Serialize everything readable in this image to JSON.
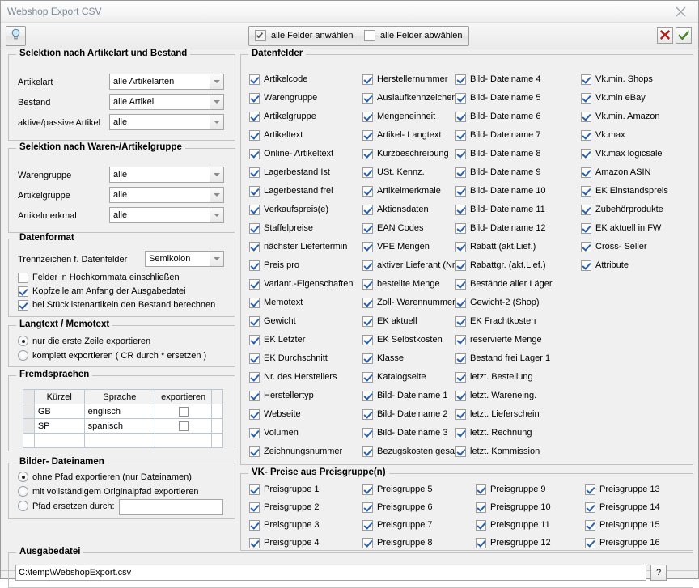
{
  "window": {
    "title": "Webshop Export CSV",
    "close_icon": "close-icon"
  },
  "toolbar": {
    "bulb_icon": "lightbulb-icon",
    "select_all_label": "alle Felder anwählen",
    "deselect_all_label": "alle Felder abwählen",
    "cancel_icon": "red-x-icon",
    "ok_icon": "green-check-icon"
  },
  "selection_article": {
    "title": "Selektion nach Artikelart und Bestand",
    "rows": [
      {
        "label": "Artikelart",
        "value": "alle Artikelarten"
      },
      {
        "label": "Bestand",
        "value": "alle Artikel"
      },
      {
        "label": "aktive/passive Artikel",
        "value": "alle"
      }
    ]
  },
  "selection_group": {
    "title": "Selektion nach Waren-/Artikelgruppe",
    "rows": [
      {
        "label": "Warengruppe",
        "value": "alle"
      },
      {
        "label": "Artikelgruppe",
        "value": "alle"
      },
      {
        "label": "Artikelmerkmal",
        "value": "alle"
      }
    ]
  },
  "datenformat": {
    "title": "Datenformat",
    "separator_label": "Trennzeichen f. Datenfelder",
    "separator_value": "Semikolon",
    "options": [
      {
        "label": "Felder in Hochkommata einschließen",
        "checked": false
      },
      {
        "label": "Kopfzeile am Anfang der Ausgabedatei",
        "checked": true
      },
      {
        "label": "bei Stücklistenartikeln den Bestand berechnen",
        "checked": true
      }
    ]
  },
  "langtext": {
    "title": "Langtext / Memotext",
    "options": [
      {
        "label": "nur die erste Zeile exportieren",
        "selected": true
      },
      {
        "label": "komplett exportieren ( CR durch * ersetzen )",
        "selected": false
      }
    ]
  },
  "fremdsprachen": {
    "title": "Fremdsprachen",
    "columns": [
      "Kürzel",
      "Sprache",
      "exportieren"
    ],
    "rows": [
      {
        "kuerzel": "GB",
        "sprache": "englisch",
        "exportieren": false
      },
      {
        "kuerzel": "SP",
        "sprache": "spanisch",
        "exportieren": false
      }
    ]
  },
  "bilder": {
    "title": "Bilder- Dateinamen",
    "options": [
      {
        "label": "ohne Pfad exportieren (nur Dateinamen)",
        "selected": true
      },
      {
        "label": "mit vollständigem Originalpfad exportieren",
        "selected": false
      },
      {
        "label": "Pfad ersetzen durch:",
        "selected": false
      }
    ],
    "replace_path_value": ""
  },
  "datenfelder": {
    "title": "Datenfelder",
    "columns": [
      {
        "items": [
          {
            "label": "Artikelcode",
            "checked": true
          },
          {
            "label": "Warengruppe",
            "checked": true
          },
          {
            "label": "Artikelgruppe",
            "checked": true
          },
          {
            "label": "Artikeltext",
            "checked": true
          },
          {
            "label": "Online- Artikeltext",
            "checked": true
          },
          {
            "label": "Lagerbestand Ist",
            "checked": true
          },
          {
            "label": "Lagerbestand frei",
            "checked": true
          },
          {
            "label": "Verkaufspreis(e)",
            "checked": true
          },
          {
            "label": "Staffelpreise",
            "checked": true
          },
          {
            "label": "nächster Liefertermin",
            "checked": true
          },
          {
            "label": "Preis pro",
            "checked": true
          },
          {
            "label": "Variant.-Eigenschaften",
            "checked": true
          },
          {
            "label": "Memotext",
            "checked": true
          },
          {
            "label": "Gewicht",
            "checked": true
          },
          {
            "label": "EK Letzter",
            "checked": true
          },
          {
            "label": "EK Durchschnitt",
            "checked": true
          },
          {
            "label": "Nr. des Herstellers",
            "checked": true
          },
          {
            "label": "Herstellertyp",
            "checked": true
          },
          {
            "label": "Webseite",
            "checked": true
          },
          {
            "label": "Volumen",
            "checked": true
          },
          {
            "label": "Zeichnungsnummer",
            "checked": true
          }
        ]
      },
      {
        "items": [
          {
            "label": "Herstellernummer",
            "checked": true
          },
          {
            "label": "Auslaufkennzeichen",
            "checked": true
          },
          {
            "label": "Mengeneinheit",
            "checked": true
          },
          {
            "label": "Artikel- Langtext",
            "checked": true
          },
          {
            "label": "Kurzbeschreibung",
            "checked": true
          },
          {
            "label": "USt. Kennz.",
            "checked": true
          },
          {
            "label": "Artikelmerkmale",
            "checked": true
          },
          {
            "label": "Aktionsdaten",
            "checked": true
          },
          {
            "label": "EAN Codes",
            "checked": true
          },
          {
            "label": "VPE Mengen",
            "checked": true
          },
          {
            "label": "aktiver Lieferant (Nr.)",
            "checked": true
          },
          {
            "label": "bestellte Menge",
            "checked": true
          },
          {
            "label": "Zoll- Warennummer",
            "checked": true
          },
          {
            "label": "EK aktuell",
            "checked": true
          },
          {
            "label": "EK Selbstkosten",
            "checked": true
          },
          {
            "label": "Klasse",
            "checked": true
          },
          {
            "label": "Katalogseite",
            "checked": true
          },
          {
            "label": "Bild- Dateiname 1",
            "checked": true
          },
          {
            "label": "Bild- Dateiname 2",
            "checked": true
          },
          {
            "label": "Bild- Dateiname 3",
            "checked": true
          },
          {
            "label": "Bezugskosten gesamt",
            "checked": true
          }
        ]
      },
      {
        "items": [
          {
            "label": "Bild- Dateiname 4",
            "checked": true
          },
          {
            "label": "Bild- Dateiname 5",
            "checked": true
          },
          {
            "label": "Bild- Dateiname 6",
            "checked": true
          },
          {
            "label": "Bild- Dateiname 7",
            "checked": true
          },
          {
            "label": "Bild- Dateiname 8",
            "checked": true
          },
          {
            "label": "Bild- Dateiname 9",
            "checked": true
          },
          {
            "label": "Bild- Dateiname 10",
            "checked": true
          },
          {
            "label": "Bild- Dateiname 11",
            "checked": true
          },
          {
            "label": "Bild- Dateiname 12",
            "checked": true
          },
          {
            "label": "Rabatt (akt.Lief.)",
            "checked": true
          },
          {
            "label": "Rabattgr. (akt.Lief.)",
            "checked": true
          },
          {
            "label": "Bestände aller Läger",
            "checked": true
          },
          {
            "label": "Gewicht-2 (Shop)",
            "checked": true
          },
          {
            "label": "EK Frachtkosten",
            "checked": true
          },
          {
            "label": "reservierte Menge",
            "checked": true
          },
          {
            "label": "Bestand frei Lager 1",
            "checked": true
          },
          {
            "label": "letzt. Bestellung",
            "checked": true
          },
          {
            "label": "letzt. Wareneing.",
            "checked": true
          },
          {
            "label": "letzt. Lieferschein",
            "checked": true
          },
          {
            "label": "letzt. Rechnung",
            "checked": true
          },
          {
            "label": "letzt. Kommission",
            "checked": true
          }
        ]
      },
      {
        "items": [
          {
            "label": "Vk.min. Shops",
            "checked": true
          },
          {
            "label": "Vk.min eBay",
            "checked": true
          },
          {
            "label": "Vk.min. Amazon",
            "checked": true
          },
          {
            "label": "Vk.max",
            "checked": true
          },
          {
            "label": "Vk.max logicsale",
            "checked": true
          },
          {
            "label": "Amazon ASIN",
            "checked": true
          },
          {
            "label": "EK Einstandspreis",
            "checked": true
          },
          {
            "label": "Zubehörprodukte",
            "checked": true
          },
          {
            "label": "EK aktuell in FW",
            "checked": true
          },
          {
            "label": "Cross- Seller",
            "checked": true
          },
          {
            "label": "Attribute",
            "checked": true
          }
        ]
      }
    ]
  },
  "preisgruppen": {
    "title": "VK- Preise aus Preisgruppe(n)",
    "columns": [
      {
        "items": [
          {
            "label": "Preisgruppe 1",
            "checked": true
          },
          {
            "label": "Preisgruppe 2",
            "checked": true
          },
          {
            "label": "Preisgruppe 3",
            "checked": true
          },
          {
            "label": "Preisgruppe 4",
            "checked": true
          }
        ]
      },
      {
        "items": [
          {
            "label": "Preisgruppe 5",
            "checked": true
          },
          {
            "label": "Preisgruppe 6",
            "checked": true
          },
          {
            "label": "Preisgruppe 7",
            "checked": true
          },
          {
            "label": "Preisgruppe 8",
            "checked": true
          }
        ]
      },
      {
        "items": [
          {
            "label": "Preisgruppe 9",
            "checked": true
          },
          {
            "label": "Preisgruppe 10",
            "checked": true
          },
          {
            "label": "Preisgruppe 11",
            "checked": true
          },
          {
            "label": "Preisgruppe 12",
            "checked": true
          }
        ]
      },
      {
        "items": [
          {
            "label": "Preisgruppe 13",
            "checked": true
          },
          {
            "label": "Preisgruppe 14",
            "checked": true
          },
          {
            "label": "Preisgruppe 15",
            "checked": true
          },
          {
            "label": "Preisgruppe 16",
            "checked": true
          }
        ]
      }
    ]
  },
  "ausgabedatei": {
    "title": "Ausgabedatei",
    "value": "C:\\temp\\WebshopExport.csv",
    "browse_label": "?"
  }
}
